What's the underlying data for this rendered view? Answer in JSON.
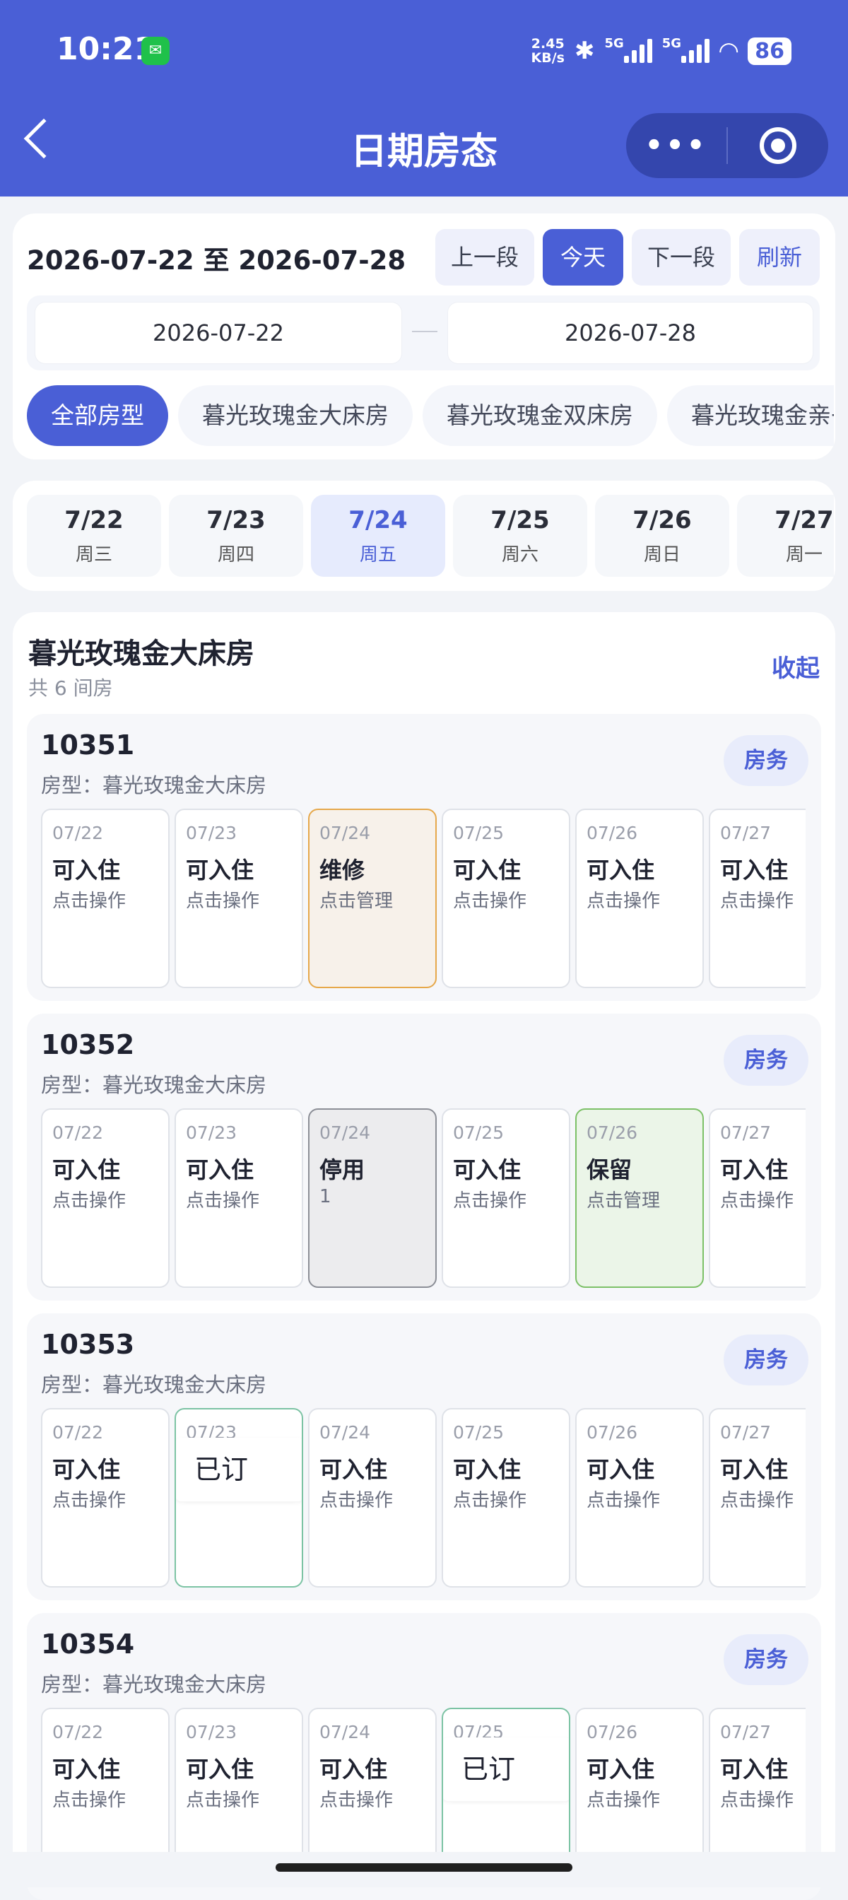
{
  "status_bar": {
    "time": "10:21",
    "speed_value": "2.45",
    "speed_unit": "KB/s",
    "net1": "5G",
    "net2": "5G",
    "battery": "86"
  },
  "nav": {
    "title": "日期房态",
    "more_icon": "more-dots-icon",
    "close_icon": "target-close-icon"
  },
  "range": {
    "label": "2026-07-22 至 2026-07-28",
    "prev": "上一段",
    "today": "今天",
    "next": "下一段",
    "refresh": "刷新",
    "start_date": "2026-07-22",
    "end_date": "2026-07-28",
    "separator": "—"
  },
  "room_type_chips": [
    {
      "label": "全部房型",
      "active": true
    },
    {
      "label": "暮光玫瑰金大床房",
      "active": false
    },
    {
      "label": "暮光玫瑰金双床房",
      "active": false
    },
    {
      "label": "暮光玫瑰金亲子",
      "active": false
    }
  ],
  "days": [
    {
      "date": "7/22",
      "weekday": "周三",
      "active": false
    },
    {
      "date": "7/23",
      "weekday": "周四",
      "active": false
    },
    {
      "date": "7/24",
      "weekday": "周五",
      "active": true
    },
    {
      "date": "7/25",
      "weekday": "周六",
      "active": false
    },
    {
      "date": "7/26",
      "weekday": "周日",
      "active": false
    },
    {
      "date": "7/27",
      "weekday": "周一",
      "active": false
    }
  ],
  "section": {
    "title": "暮光玫瑰金大床房",
    "count": "共 6 间房",
    "collapse": "收起"
  },
  "rooms": [
    {
      "number": "10351",
      "type": "房型：暮光玫瑰金大床房",
      "service": "房务",
      "cells": [
        {
          "date": "07/22",
          "status": "可入住",
          "action": "点击操作",
          "kind": "free"
        },
        {
          "date": "07/23",
          "status": "可入住",
          "action": "点击操作",
          "kind": "free"
        },
        {
          "date": "07/24",
          "status": "维修",
          "action": "点击管理",
          "kind": "repair"
        },
        {
          "date": "07/25",
          "status": "可入住",
          "action": "点击操作",
          "kind": "free"
        },
        {
          "date": "07/26",
          "status": "可入住",
          "action": "点击操作",
          "kind": "free"
        },
        {
          "date": "07/27",
          "status": "可入住",
          "action": "点击操作",
          "kind": "free"
        }
      ]
    },
    {
      "number": "10352",
      "type": "房型：暮光玫瑰金大床房",
      "service": "房务",
      "cells": [
        {
          "date": "07/22",
          "status": "可入住",
          "action": "点击操作",
          "kind": "free"
        },
        {
          "date": "07/23",
          "status": "可入住",
          "action": "点击操作",
          "kind": "free"
        },
        {
          "date": "07/24",
          "status": "停用",
          "action": "1",
          "kind": "stop"
        },
        {
          "date": "07/25",
          "status": "可入住",
          "action": "点击操作",
          "kind": "free"
        },
        {
          "date": "07/26",
          "status": "保留",
          "action": "点击管理",
          "kind": "hold"
        },
        {
          "date": "07/27",
          "status": "可入住",
          "action": "点击操作",
          "kind": "free"
        }
      ]
    },
    {
      "number": "10353",
      "type": "房型：暮光玫瑰金大床房",
      "service": "房务",
      "cells": [
        {
          "date": "07/22",
          "status": "可入住",
          "action": "点击操作",
          "kind": "free"
        },
        {
          "date": "07/23",
          "status": "已订",
          "action": "",
          "kind": "booked"
        },
        {
          "date": "07/24",
          "status": "可入住",
          "action": "点击操作",
          "kind": "free"
        },
        {
          "date": "07/25",
          "status": "可入住",
          "action": "点击操作",
          "kind": "free"
        },
        {
          "date": "07/26",
          "status": "可入住",
          "action": "点击操作",
          "kind": "free"
        },
        {
          "date": "07/27",
          "status": "可入住",
          "action": "点击操作",
          "kind": "free"
        }
      ]
    },
    {
      "number": "10354",
      "type": "房型：暮光玫瑰金大床房",
      "service": "房务",
      "cells": [
        {
          "date": "07/22",
          "status": "可入住",
          "action": "点击操作",
          "kind": "free"
        },
        {
          "date": "07/23",
          "status": "可入住",
          "action": "点击操作",
          "kind": "free"
        },
        {
          "date": "07/24",
          "status": "可入住",
          "action": "点击操作",
          "kind": "free"
        },
        {
          "date": "07/25",
          "status": "已订",
          "action": "",
          "kind": "booked"
        },
        {
          "date": "07/26",
          "status": "可入住",
          "action": "点击操作",
          "kind": "free"
        },
        {
          "date": "07/27",
          "status": "可入住",
          "action": "点击操作",
          "kind": "free"
        }
      ]
    }
  ],
  "colors": {
    "primary": "#4a5fd6",
    "repair": "#e6a84a",
    "hold": "#7cc067",
    "booked": "#7cc3a4",
    "stop": "#8b8e96"
  }
}
